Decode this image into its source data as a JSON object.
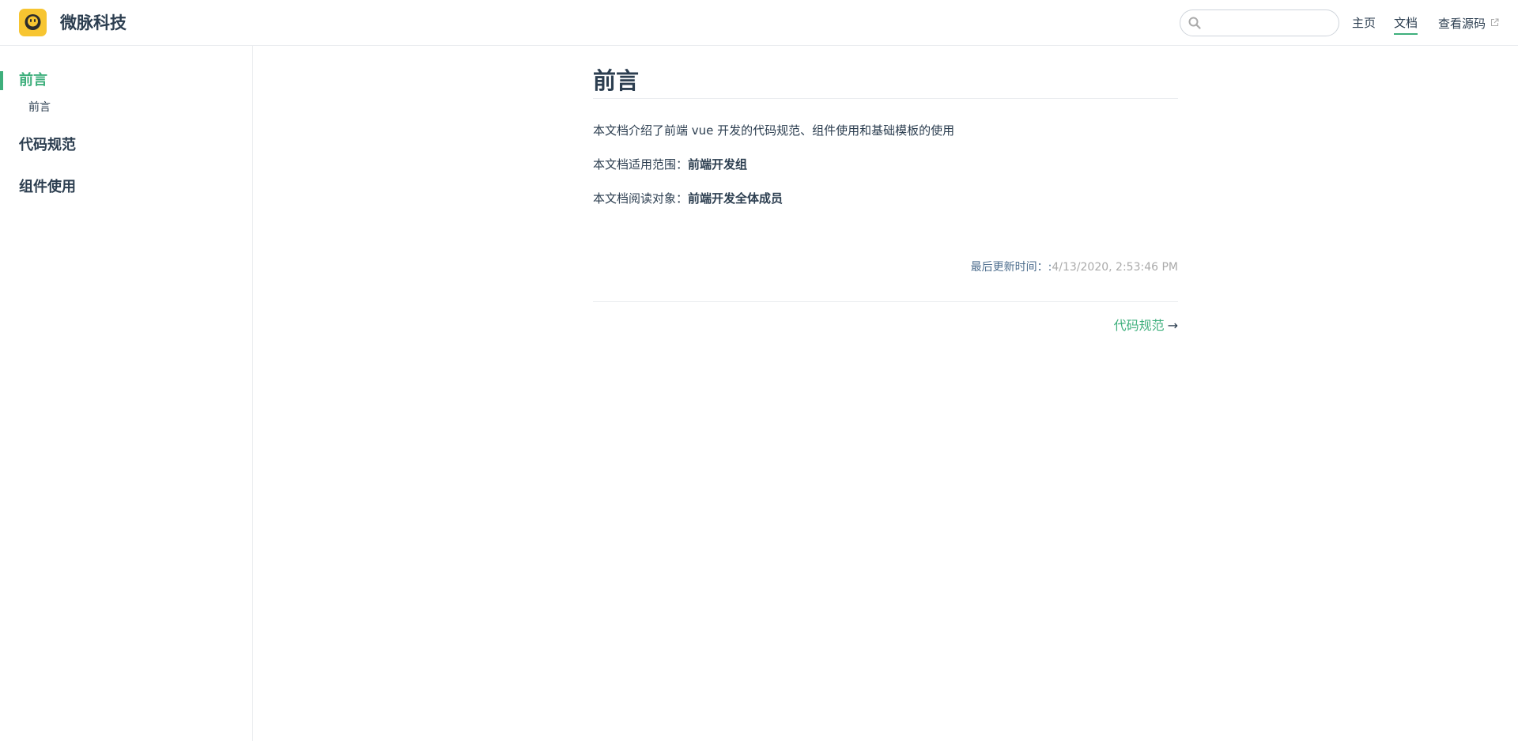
{
  "header": {
    "site_name": "微脉科技",
    "search": {
      "value": "",
      "placeholder": ""
    },
    "nav": [
      {
        "label": "主页"
      },
      {
        "label": "文档",
        "active": true
      },
      {
        "label": "查看源码",
        "external": true
      }
    ]
  },
  "sidebar": {
    "groups": [
      {
        "title": "前言",
        "active": true,
        "children": [
          {
            "label": "前言"
          }
        ]
      },
      {
        "title": "代码规范"
      },
      {
        "title": "组件使用"
      }
    ]
  },
  "main": {
    "title": "前言",
    "intro": "本文档介绍了前端 vue 开发的代码规范、组件使用和基础模板的使用",
    "scope_label": "本文档适用范围：",
    "scope_value": "前端开发组",
    "audience_label": "本文档阅读对象：",
    "audience_value": "前端开发全体成员",
    "last_updated_prefix": "最后更新时间：:",
    "last_updated_time": "4/13/2020, 2:53:46 PM",
    "next_label": "代码规范",
    "next_arrow": "→"
  },
  "colors": {
    "accent": "#3eaf7c",
    "text": "#2c3e50",
    "logo": "#f7c531",
    "muted": "#aaaaaa"
  }
}
